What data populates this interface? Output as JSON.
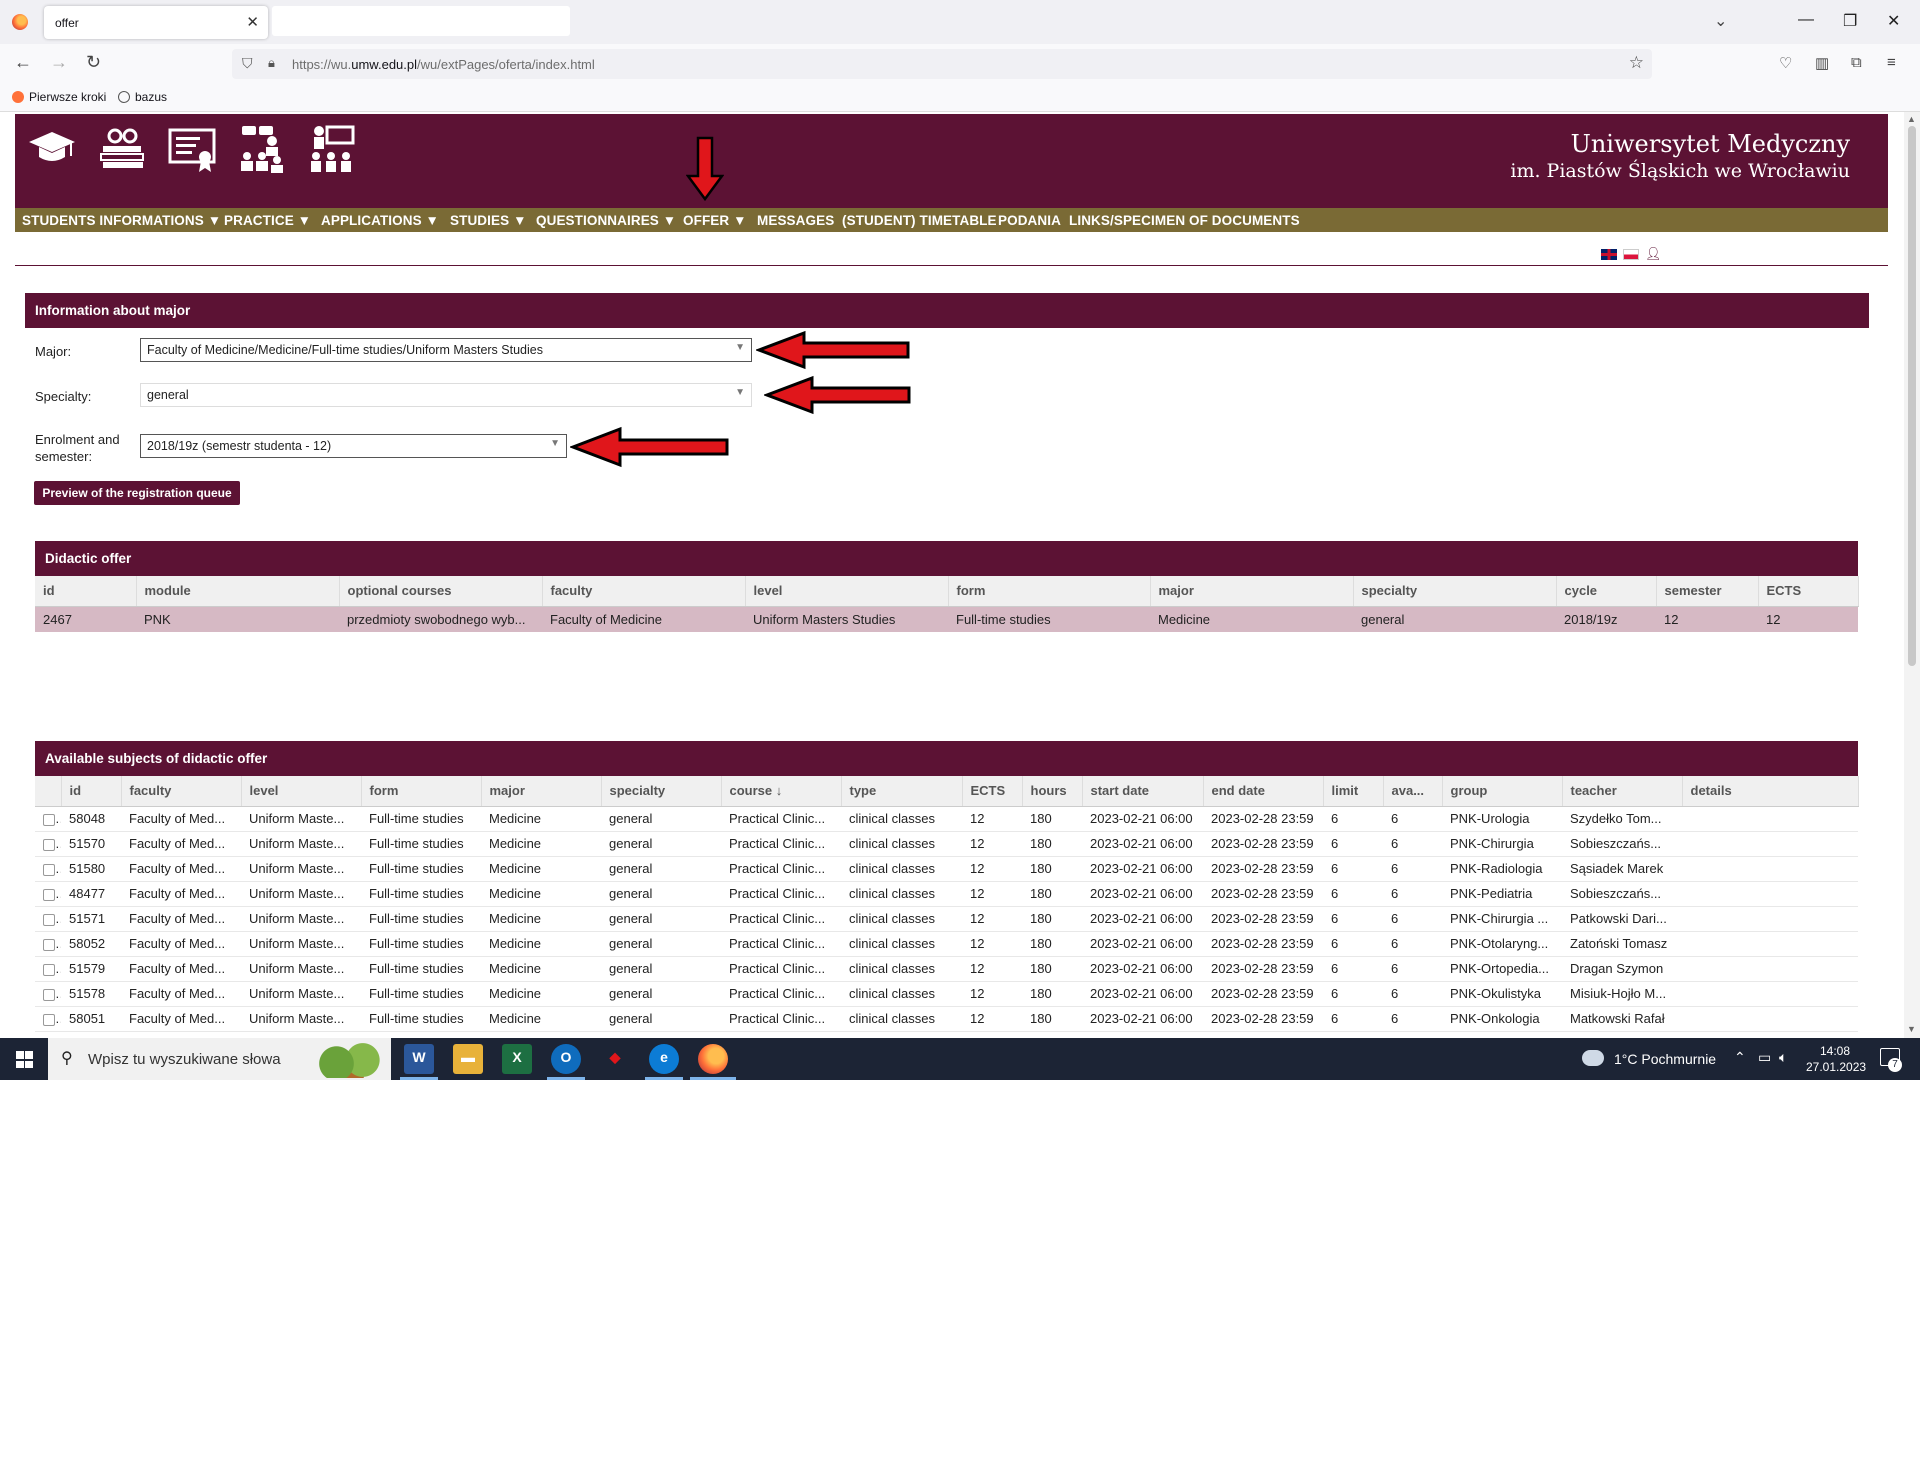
{
  "browser": {
    "tab_title": "offer",
    "url_prefix": "https://wu.",
    "url_domain": "umw.edu.pl",
    "url_path": "/wu/extPages/oferta/index.html",
    "bookmarks": [
      "Pierwsze kroki",
      "bazus"
    ]
  },
  "header": {
    "university_line1": "Uniwersytet Medyczny",
    "university_line2": "im. Piastów Śląskich we Wrocławiu",
    "icons": [
      "graduation-cap-icon",
      "books-icon",
      "certificate-icon",
      "students-group-icon",
      "lecture-icon"
    ]
  },
  "menu": [
    {
      "label": "STUDENTS INFORMATIONS",
      "dropdown": true
    },
    {
      "label": "PRACTICE",
      "dropdown": true
    },
    {
      "label": "APPLICATIONS",
      "dropdown": true
    },
    {
      "label": "STUDIES",
      "dropdown": true
    },
    {
      "label": "QUESTIONNAIRES",
      "dropdown": true
    },
    {
      "label": "OFFER",
      "dropdown": true
    },
    {
      "label": "MESSAGES",
      "dropdown": false
    },
    {
      "label": "(STUDENT) TIMETABLE",
      "dropdown": false
    },
    {
      "label": "PODANIA",
      "dropdown": false
    },
    {
      "label": "LINKS/SPECIMEN OF DOCUMENTS",
      "dropdown": false
    }
  ],
  "major_info": {
    "title": "Information about major",
    "major_label": "Major:",
    "major_value": "Faculty of Medicine/Medicine/Full-time studies/Uniform Masters Studies",
    "specialty_label": "Specialty:",
    "specialty_value": "general",
    "enrolment_label": "Enrolment and semester:",
    "enrolment_value": "2018/19z (semestr studenta - 12)",
    "queue_button": "Preview of the registration queue"
  },
  "didactic_offer": {
    "title": "Didactic offer",
    "columns": [
      "id",
      "module",
      "optional courses",
      "faculty",
      "level",
      "form",
      "major",
      "specialty",
      "cycle",
      "semester",
      "ECTS"
    ],
    "rows": [
      [
        "2467",
        "PNK",
        "przedmioty swobodnego wyb...",
        "Faculty of Medicine",
        "Uniform Masters Studies",
        "Full-time studies",
        "Medicine",
        "general",
        "2018/19z",
        "12",
        "12"
      ]
    ]
  },
  "subjects": {
    "title": "Available subjects of didactic offer",
    "columns": [
      "",
      "id",
      "faculty",
      "level",
      "form",
      "major",
      "specialty",
      "course ↓",
      "type",
      "ECTS",
      "hours",
      "start date",
      "end date",
      "limit",
      "ava...",
      "group",
      "teacher",
      "details"
    ],
    "rows": [
      [
        "",
        "58048",
        "Faculty of Med...",
        "Uniform Maste...",
        "Full-time studies",
        "Medicine",
        "general",
        "Practical Clinic...",
        "clinical classes",
        "12",
        "180",
        "2023-02-21 06:00",
        "2023-02-28 23:59",
        "6",
        "6",
        "PNK-Urologia",
        "Szydełko Tom...",
        ""
      ],
      [
        "",
        "51570",
        "Faculty of Med...",
        "Uniform Maste...",
        "Full-time studies",
        "Medicine",
        "general",
        "Practical Clinic...",
        "clinical classes",
        "12",
        "180",
        "2023-02-21 06:00",
        "2023-02-28 23:59",
        "6",
        "6",
        "PNK-Chirurgia",
        "Sobieszczańs...",
        ""
      ],
      [
        "",
        "51580",
        "Faculty of Med...",
        "Uniform Maste...",
        "Full-time studies",
        "Medicine",
        "general",
        "Practical Clinic...",
        "clinical classes",
        "12",
        "180",
        "2023-02-21 06:00",
        "2023-02-28 23:59",
        "6",
        "6",
        "PNK-Radiologia",
        "Sąsiadek Marek",
        ""
      ],
      [
        "",
        "48477",
        "Faculty of Med...",
        "Uniform Maste...",
        "Full-time studies",
        "Medicine",
        "general",
        "Practical Clinic...",
        "clinical classes",
        "12",
        "180",
        "2023-02-21 06:00",
        "2023-02-28 23:59",
        "6",
        "6",
        "PNK-Pediatria",
        "Sobieszczańs...",
        ""
      ],
      [
        "",
        "51571",
        "Faculty of Med...",
        "Uniform Maste...",
        "Full-time studies",
        "Medicine",
        "general",
        "Practical Clinic...",
        "clinical classes",
        "12",
        "180",
        "2023-02-21 06:00",
        "2023-02-28 23:59",
        "6",
        "6",
        "PNK-Chirurgia ...",
        "Patkowski Dari...",
        ""
      ],
      [
        "",
        "58052",
        "Faculty of Med...",
        "Uniform Maste...",
        "Full-time studies",
        "Medicine",
        "general",
        "Practical Clinic...",
        "clinical classes",
        "12",
        "180",
        "2023-02-21 06:00",
        "2023-02-28 23:59",
        "6",
        "6",
        "PNK-Otolaryng...",
        "Zatoński Tomasz",
        ""
      ],
      [
        "",
        "51579",
        "Faculty of Med...",
        "Uniform Maste...",
        "Full-time studies",
        "Medicine",
        "general",
        "Practical Clinic...",
        "clinical classes",
        "12",
        "180",
        "2023-02-21 06:00",
        "2023-02-28 23:59",
        "6",
        "6",
        "PNK-Ortopedia...",
        "Dragan Szymon",
        ""
      ],
      [
        "",
        "51578",
        "Faculty of Med...",
        "Uniform Maste...",
        "Full-time studies",
        "Medicine",
        "general",
        "Practical Clinic...",
        "clinical classes",
        "12",
        "180",
        "2023-02-21 06:00",
        "2023-02-28 23:59",
        "6",
        "6",
        "PNK-Okulistyka",
        "Misiuk-Hojło M...",
        ""
      ],
      [
        "",
        "58051",
        "Faculty of Med...",
        "Uniform Maste...",
        "Full-time studies",
        "Medicine",
        "general",
        "Practical Clinic...",
        "clinical classes",
        "12",
        "180",
        "2023-02-21 06:00",
        "2023-02-28 23:59",
        "6",
        "6",
        "PNK-Onkologia",
        "Matkowski Rafał",
        ""
      ]
    ]
  },
  "taskbar": {
    "search_placeholder": "Wpisz tu wyszukiwane słowa",
    "weather": "1°C Pochmurnie",
    "time": "14:08",
    "date": "27.01.2023",
    "notifications": "7"
  },
  "colors": {
    "brand_maroon": "#5c1234",
    "menu_olive": "#7a6a35",
    "selected_row": "#d6b9c4",
    "annotation_arrow": "#e0161b"
  }
}
